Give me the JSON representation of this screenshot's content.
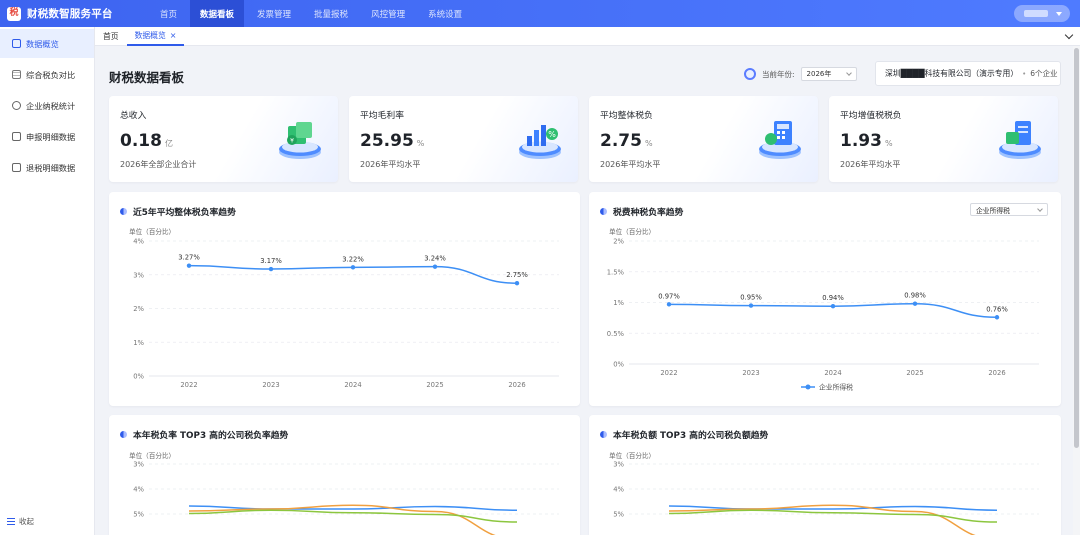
{
  "app": {
    "title": "财税数智服务平台",
    "logo_glyph": "税"
  },
  "topnav": [
    {
      "label": "首页",
      "active": false
    },
    {
      "label": "数据看板",
      "active": true
    },
    {
      "label": "发票管理",
      "active": false
    },
    {
      "label": "批量报税",
      "active": false
    },
    {
      "label": "风控管理",
      "active": false
    },
    {
      "label": "系统设置",
      "active": false
    }
  ],
  "sidebar": {
    "items": [
      {
        "label": "数据概览",
        "icon": "monitor-icon",
        "active": true
      },
      {
        "label": "综合税负对比",
        "icon": "grid-icon",
        "active": false
      },
      {
        "label": "企业纳税统计",
        "icon": "pie-icon",
        "active": false
      },
      {
        "label": "申报明细数据",
        "icon": "document-icon",
        "active": false
      },
      {
        "label": "退税明细数据",
        "icon": "document-icon",
        "active": false
      }
    ],
    "collapse_label": "收起"
  },
  "tabs": [
    {
      "label": "首页",
      "active": false
    },
    {
      "label": "数据概览",
      "active": true,
      "close": "×"
    }
  ],
  "dashboard": {
    "title": "财税数据看板",
    "year_label": "当前年份:",
    "year_value": "2026年",
    "company_name": "深圳████科技有限公司（演示专用）",
    "company_sep": "•",
    "company_count": "6个企业"
  },
  "stats": [
    {
      "label": "总收入",
      "value": "0.18",
      "unit": "亿",
      "sub": "2026年全部企业合计",
      "icon": "money-stack-icon"
    },
    {
      "label": "平均毛利率",
      "value": "25.95",
      "unit": "%",
      "sub": "2026年平均水平",
      "icon": "bar-chart-percent-icon"
    },
    {
      "label": "平均整体税负",
      "value": "2.75",
      "unit": "%",
      "sub": "2026年平均水平",
      "icon": "tax-calculator-icon"
    },
    {
      "label": "平均增值税税负",
      "value": "1.93",
      "unit": "%",
      "sub": "2026年平均水平",
      "icon": "vat-document-icon"
    }
  ],
  "charts": {
    "trend5": {
      "title": "近5年平均整体税负率趋势",
      "unit": "单位（百分比）"
    },
    "taxtype": {
      "title": "税费种税负率趋势",
      "unit": "单位（百分比）",
      "select_value": "企业所得税"
    },
    "top3rate": {
      "title": "本年税负率 TOP3 高的公司税负率趋势",
      "unit": "单位（百分比）"
    },
    "top3amount": {
      "title": "本年税负额 TOP3 高的公司税负额趋势",
      "unit": "单位（百分比）"
    }
  },
  "colors": {
    "primary": "#3d64f0",
    "line": "#3d8ff5",
    "orange": "#f0a040",
    "green": "#8cc63f"
  },
  "chart_data": [
    {
      "type": "line",
      "title": "近5年平均整体税负率趋势",
      "ylabel": "单位（百分比）",
      "categories": [
        "2022",
        "2023",
        "2024",
        "2025",
        "2026"
      ],
      "series": [
        {
          "values": [
            3.27,
            3.17,
            3.22,
            3.24,
            2.75
          ],
          "labels": [
            "3.27%",
            "3.17%",
            "3.22%",
            "3.24%",
            "2.75%"
          ]
        }
      ],
      "ylim": [
        0,
        4
      ],
      "yticks": [
        "0%",
        "1%",
        "2%",
        "3%",
        "4%"
      ],
      "grid": true
    },
    {
      "type": "line",
      "title": "税费种税负率趋势",
      "ylabel": "单位（百分比）",
      "categories": [
        "2022",
        "2023",
        "2024",
        "2025",
        "2026"
      ],
      "series": [
        {
          "name": "企业所得税",
          "values": [
            0.97,
            0.95,
            0.94,
            0.98,
            0.76
          ],
          "labels": [
            "0.97%",
            "0.95%",
            "0.94%",
            "0.98%",
            "0.76%"
          ]
        }
      ],
      "ylim": [
        0,
        2
      ],
      "yticks": [
        "0%",
        "0.5%",
        "1%",
        "1.5%",
        "2%"
      ],
      "legend": "bottom",
      "grid": true
    },
    {
      "type": "line",
      "title": "本年税负率 TOP3 高的公司税负率趋势",
      "ylabel": "单位（百分比）",
      "categories": [
        "2022",
        "2023",
        "2024",
        "2025",
        "2026"
      ],
      "series": [
        {
          "color": "#3d8ff5",
          "values": [
            3.32,
            3.2,
            3.2,
            3.3,
            3.15
          ]
        },
        {
          "color": "#f0a040",
          "values": [
            3.12,
            3.2,
            3.35,
            3.1,
            2.0
          ]
        },
        {
          "color": "#8cc63f",
          "values": [
            3.02,
            3.15,
            3.05,
            2.98,
            2.68
          ]
        }
      ],
      "ylim": [
        0,
        5
      ],
      "yticks": [
        "3%",
        "4%",
        "5%"
      ],
      "grid": true
    },
    {
      "type": "line",
      "title": "本年税负额 TOP3 高的公司税负额趋势",
      "ylabel": "单位（百分比）",
      "categories": [
        "2022",
        "2023",
        "2024",
        "2025",
        "2026"
      ],
      "series": [
        {
          "color": "#3d8ff5",
          "values": [
            3.32,
            3.2,
            3.2,
            3.3,
            3.15
          ]
        },
        {
          "color": "#f0a040",
          "values": [
            3.12,
            3.2,
            3.35,
            3.1,
            2.0
          ]
        },
        {
          "color": "#8cc63f",
          "values": [
            3.02,
            3.15,
            3.05,
            2.98,
            2.68
          ]
        }
      ],
      "ylim": [
        0,
        5
      ],
      "yticks": [
        "3%",
        "4%",
        "5%"
      ],
      "grid": true
    }
  ]
}
